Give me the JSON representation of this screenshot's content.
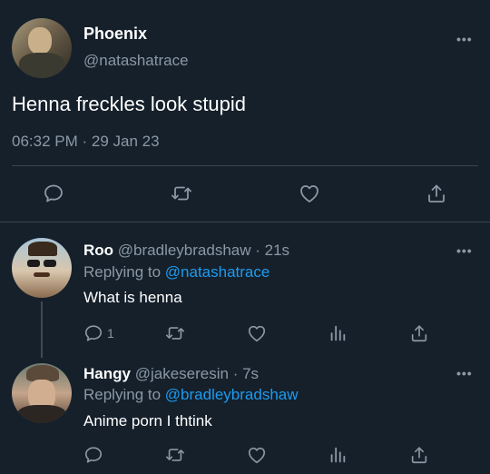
{
  "main_tweet": {
    "display_name": "Phoenix",
    "handle": "@natashatrace",
    "text": "Henna freckles look stupid",
    "timestamp": "06:32 PM · 29 Jan 23",
    "more_icon": "more-horizontal-icon",
    "actions": [
      "reply-icon",
      "retweet-icon",
      "like-icon",
      "share-icon"
    ]
  },
  "replies": [
    {
      "display_name": "Roo",
      "handle": "@bradleybradshaw",
      "time": "· 21s",
      "replying_prefix": "Replying to",
      "replying_handle": "@natashatrace",
      "text": "What is henna",
      "reply_count": "1"
    },
    {
      "display_name": "Hangy",
      "handle": "@jakeseresin",
      "time": "· 7s",
      "replying_prefix": "Replying to",
      "replying_handle": "@bradleybradshaw",
      "text": "Anime porn I thtink",
      "reply_count": ""
    }
  ],
  "colors": {
    "background": "#15202b",
    "muted": "#8b98a5",
    "link": "#1d9bf0",
    "separator": "#38444d"
  }
}
